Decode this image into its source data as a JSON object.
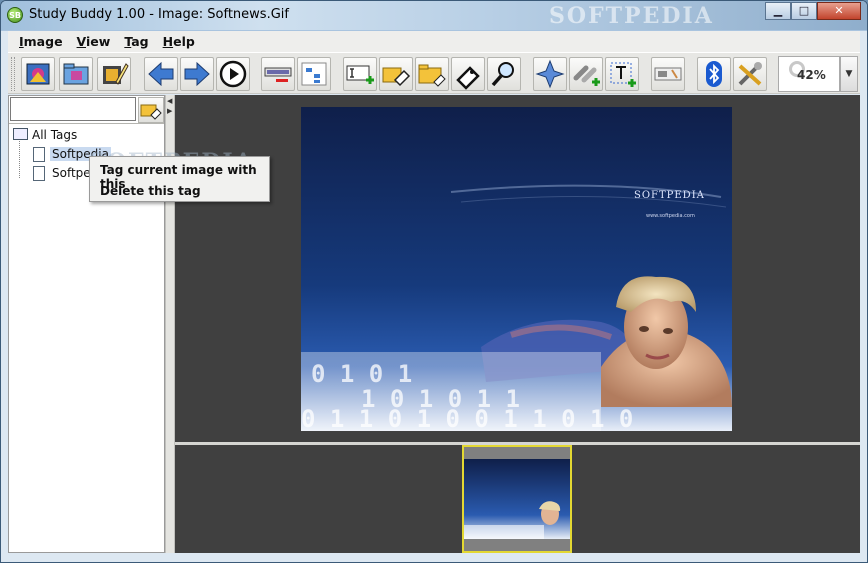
{
  "window": {
    "title": "Study Buddy 1.00  - Image: Softnews.Gif",
    "app_icon_text": "SB",
    "watermark": "SOFTPEDIA",
    "controls": {
      "minimize": "▁",
      "maximize": "□",
      "close": "✕"
    }
  },
  "menu": {
    "items": [
      {
        "first": "I",
        "rest": "mage"
      },
      {
        "first": "V",
        "rest": "iew"
      },
      {
        "first": "T",
        "rest": "ag"
      },
      {
        "first": "H",
        "rest": "elp"
      }
    ]
  },
  "toolbar": {
    "buttons": [
      "open-images-icon",
      "open-folder-icon",
      "edit-image-icon",
      "previous-arrow-icon",
      "next-arrow-icon",
      "slideshow-play-icon",
      "remove-tag-icon",
      "tag-hierarchy-icon",
      "add-text-icon",
      "tag-image-icon",
      "tag-folder-icon",
      "untag-icon",
      "find-tag-icon",
      "navigate-icon",
      "link-add-icon",
      "text-tool-icon",
      "settings-panel-icon",
      "bluetooth-icon",
      "tools-icon"
    ],
    "zoom": "42%"
  },
  "leftpane": {
    "search_value": "",
    "tree": {
      "root": "All Tags",
      "children": [
        "Softpedia",
        "Softpedia"
      ]
    }
  },
  "context_menu": {
    "items": [
      "Tag current image with this",
      "Delete this tag"
    ],
    "watermark": "SOFTPEDIA"
  },
  "image": {
    "brand": "SOFTPEDIA",
    "url_text": "www.softpedia.com"
  },
  "colors": {
    "viewer_bg": "#404040",
    "thumb_border": "#e3d832",
    "image_top": "#0f1f4a",
    "image_bottom": "#1c4a9a"
  }
}
